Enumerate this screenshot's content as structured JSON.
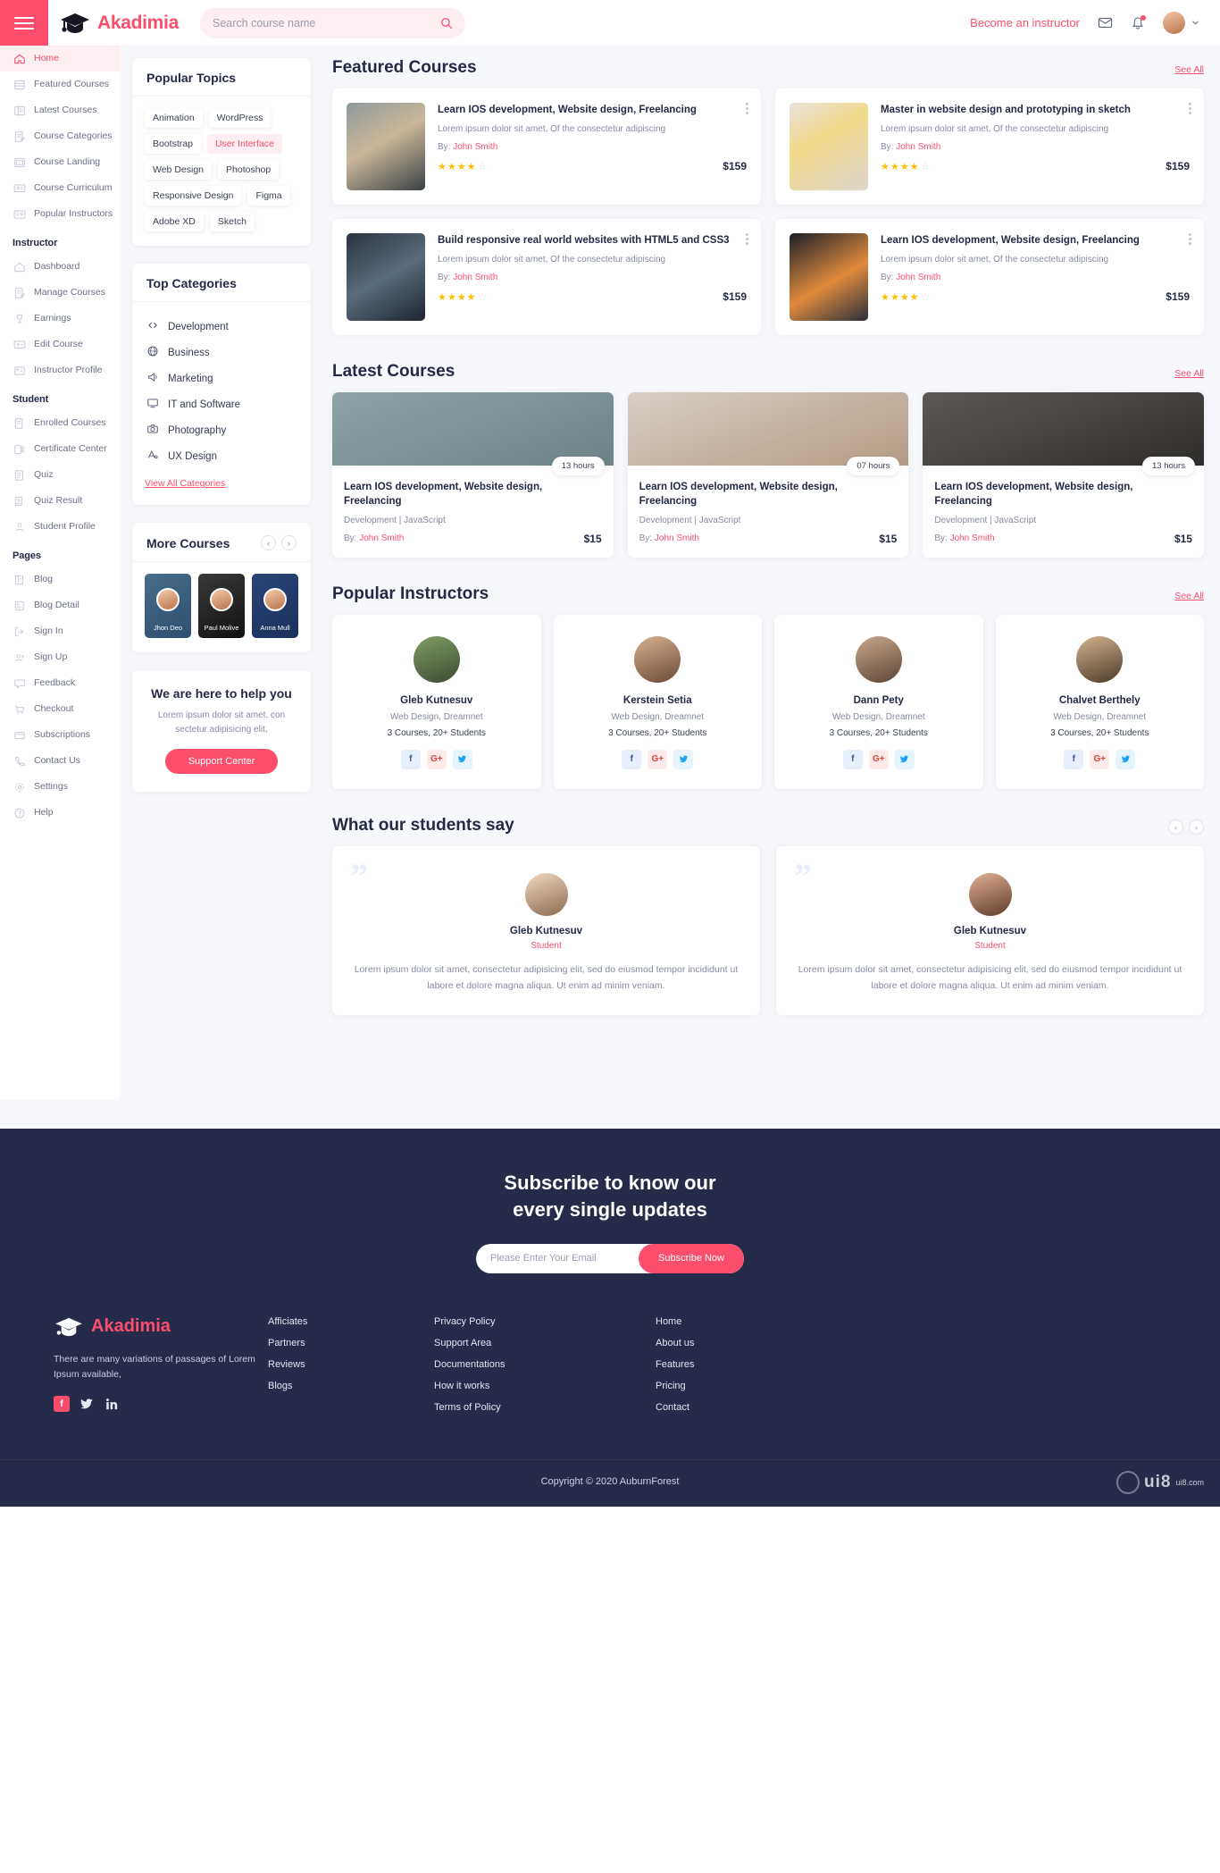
{
  "brand": {
    "name": "Akadimia"
  },
  "topbar": {
    "search_placeholder": "Search course name",
    "instructor_link": "Become an instructor"
  },
  "sidebar": {
    "main_items": [
      {
        "label": "Home",
        "icon": "home-icon",
        "active": true
      },
      {
        "label": "Featured Courses",
        "icon": "featured-icon",
        "active": false
      },
      {
        "label": "Latest Courses",
        "icon": "latest-icon",
        "active": false
      },
      {
        "label": "Course Categories",
        "icon": "categories-icon",
        "active": false
      },
      {
        "label": "Course Landing",
        "icon": "landing-icon",
        "active": false
      },
      {
        "label": "Course Curriculum",
        "icon": "curriculum-icon",
        "active": false
      },
      {
        "label": "Popular Instructors",
        "icon": "instructors-icon",
        "active": false
      }
    ],
    "groups": [
      {
        "title": "Instructor",
        "items": [
          {
            "label": "Dashboard",
            "icon": "dashboard-icon"
          },
          {
            "label": "Manage Courses",
            "icon": "manage-icon"
          },
          {
            "label": "Earnings",
            "icon": "earnings-icon"
          },
          {
            "label": "Edit Course",
            "icon": "edit-icon"
          },
          {
            "label": "Instructor Profile",
            "icon": "profile-icon"
          }
        ]
      },
      {
        "title": "Student",
        "items": [
          {
            "label": "Enrolled Courses",
            "icon": "enrolled-icon"
          },
          {
            "label": "Certificate Center",
            "icon": "certificate-icon"
          },
          {
            "label": "Quiz",
            "icon": "quiz-icon"
          },
          {
            "label": "Quiz Result",
            "icon": "quiz-result-icon"
          },
          {
            "label": "Student Profile",
            "icon": "student-icon"
          }
        ]
      },
      {
        "title": "Pages",
        "items": [
          {
            "label": "Blog",
            "icon": "blog-icon"
          },
          {
            "label": "Blog Detail",
            "icon": "blog-detail-icon"
          },
          {
            "label": "Sign In",
            "icon": "signin-icon"
          },
          {
            "label": "Sign Up",
            "icon": "signup-icon"
          },
          {
            "label": "Feedback",
            "icon": "feedback-icon"
          },
          {
            "label": "Checkout",
            "icon": "checkout-icon"
          },
          {
            "label": "Subscriptions",
            "icon": "subscriptions-icon"
          },
          {
            "label": "Contact Us",
            "icon": "contact-icon"
          },
          {
            "label": "Settings",
            "icon": "settings-icon"
          },
          {
            "label": "Help",
            "icon": "help-icon"
          }
        ]
      }
    ]
  },
  "popular_topics": {
    "title": "Popular Topics",
    "tags": [
      {
        "label": "Animation",
        "accent": false
      },
      {
        "label": "WordPress",
        "accent": false
      },
      {
        "label": "Bootstrap",
        "accent": false
      },
      {
        "label": "User Interface",
        "accent": true
      },
      {
        "label": "Web Design",
        "accent": false
      },
      {
        "label": "Photoshop",
        "accent": false
      },
      {
        "label": "Responsive Design",
        "accent": false
      },
      {
        "label": "Figma",
        "accent": false
      },
      {
        "label": "Adobe XD",
        "accent": false
      },
      {
        "label": "Sketch",
        "accent": false
      }
    ]
  },
  "top_categories": {
    "title": "Top Categories",
    "items": [
      {
        "label": "Development",
        "icon": "development-icon"
      },
      {
        "label": "Business",
        "icon": "business-icon"
      },
      {
        "label": "Marketing",
        "icon": "marketing-icon"
      },
      {
        "label": "IT and Software",
        "icon": "it-software-icon"
      },
      {
        "label": "Photography",
        "icon": "photography-icon"
      },
      {
        "label": "UX Design",
        "icon": "ux-design-icon"
      }
    ],
    "view_all": "View All Categories"
  },
  "more_courses": {
    "title": "More Courses",
    "items": [
      {
        "name": "Jhon Deo"
      },
      {
        "name": "Paul Molive"
      },
      {
        "name": "Anna Mull"
      }
    ]
  },
  "help_card": {
    "title": "We are here to help you",
    "text": "Lorem ipsum dolor sit amet, con sectetur adipisicing elit,",
    "button": "Support Center"
  },
  "featured": {
    "title": "Featured Courses",
    "see_all": "See All",
    "courses": [
      {
        "title": "Learn IOS development, Website design, Freelancing",
        "desc": "Lorem ipsum dolor sit amet, Of the consectetur adipiscing",
        "by_label": "By:",
        "author": "John Smith",
        "rating": 4,
        "price": "$159"
      },
      {
        "title": "Master in website design and prototyping in sketch",
        "desc": "Lorem ipsum dolor sit amet, Of the consectetur adipiscing",
        "by_label": "By:",
        "author": "John Smith",
        "rating": 4,
        "price": "$159"
      },
      {
        "title": "Build responsive real world websites with HTML5 and CSS3",
        "desc": "Lorem ipsum dolor sit amet, Of the consectetur adipiscing",
        "by_label": "By:",
        "author": "John Smith",
        "rating": 4,
        "price": "$159"
      },
      {
        "title": "Learn IOS development, Website design, Freelancing",
        "desc": "Lorem ipsum dolor sit amet, Of the consectetur adipiscing",
        "by_label": "By:",
        "author": "John Smith",
        "rating": 4,
        "price": "$159"
      }
    ]
  },
  "latest": {
    "title": "Latest Courses",
    "see_all": "See All",
    "courses": [
      {
        "title": "Learn IOS development, Website design, Freelancing",
        "meta": "Development  |  JavaScript",
        "hours": "13 hours",
        "by_label": "By:",
        "author": "John Smith",
        "price": "$15"
      },
      {
        "title": "Learn IOS development, Website design, Freelancing",
        "meta": "Development  |  JavaScript",
        "hours": "07 hours",
        "by_label": "By:",
        "author": "John Smith",
        "price": "$15"
      },
      {
        "title": "Learn IOS development, Website design, Freelancing",
        "meta": "Development  |  JavaScript",
        "hours": "13 hours",
        "by_label": "By:",
        "author": "John Smith",
        "price": "$15"
      }
    ]
  },
  "instructors": {
    "title": "Popular Instructors",
    "see_all": "See All",
    "items": [
      {
        "name": "Gleb Kutnesuv",
        "role": "Web Design, Dreamnet",
        "stats": "3 Courses, 20+ Students"
      },
      {
        "name": "Kerstein Setia",
        "role": "Web Design, Dreamnet",
        "stats": "3 Courses, 20+ Students"
      },
      {
        "name": "Dann Pety",
        "role": "Web Design, Dreamnet",
        "stats": "3 Courses, 20+ Students"
      },
      {
        "name": "Chalvet Berthely",
        "role": "Web Design, Dreamnet",
        "stats": "3 Courses, 20+ Students"
      }
    ],
    "social": {
      "facebook": "f",
      "google": "G+",
      "twitter": "t"
    }
  },
  "testimonials": {
    "title": "What our students say",
    "items": [
      {
        "name": "Gleb Kutnesuv",
        "role": "Student",
        "text": "Lorem ipsum dolor sit amet, consectetur adipisicing elit, sed do eiusmod tempor incididunt ut labore et dolore magna aliqua. Ut enim ad minim veniam."
      },
      {
        "name": "Gleb Kutnesuv",
        "role": "Student",
        "text": "Lorem ipsum dolor sit amet, consectetur adipisicing elit, sed do eiusmod tempor incididunt ut labore et dolore magna aliqua. Ut enim ad minim veniam."
      }
    ]
  },
  "footer": {
    "subscribe_title_line1": "Subscribe to know our",
    "subscribe_title_line2": "every single updates",
    "email_placeholder": "Please Enter Your Email",
    "subscribe_button": "Subscribe Now",
    "brand": "Akadimia",
    "about": "There are many variations of passages of Lorem Ipsum available,",
    "columns": [
      {
        "links": [
          "Afficiates",
          "Partners",
          "Reviews",
          "Blogs"
        ]
      },
      {
        "links": [
          "Privacy Policy",
          "Support Area",
          "Documentations",
          "How it works",
          "Terms of Policy"
        ]
      },
      {
        "links": [
          "Home",
          "About us",
          "Features",
          "Pricing",
          "Contact"
        ]
      }
    ],
    "copyright": "Copyright © 2020 AuburnForest",
    "watermark": "ui8",
    "watermark_sub": "ui8.com"
  },
  "colors": {
    "accent": "#fb4e6d",
    "dark": "#262b4a",
    "bg": "#f7f8fc"
  }
}
